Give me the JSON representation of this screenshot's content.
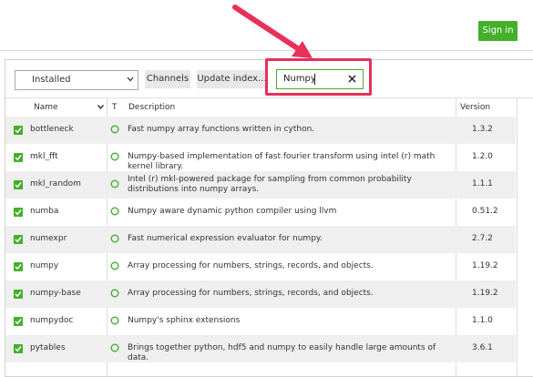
{
  "header": {
    "signin_label": "Sign in"
  },
  "toolbar": {
    "filter_selected": "Installed",
    "channels_label": "Channels",
    "update_index_label": "Update index...",
    "search_value": "Numpy"
  },
  "table": {
    "columns": {
      "name": "Name",
      "type": "T",
      "description": "Description",
      "version": "Version"
    },
    "rows": [
      {
        "name": "bottleneck",
        "description": "Fast numpy array functions written in cython.",
        "version": "1.3.2"
      },
      {
        "name": "mkl_fft",
        "description": "Numpy-based implementation of fast fourier transform using intel (r) math kernel library.",
        "version": "1.2.0"
      },
      {
        "name": "mkl_random",
        "description": "Intel (r) mkl-powered package for sampling from common probability distributions into numpy arrays.",
        "version": "1.1.1"
      },
      {
        "name": "numba",
        "description": "Numpy aware dynamic python compiler using llvm",
        "version": "0.51.2"
      },
      {
        "name": "numexpr",
        "description": "Fast numerical expression evaluator for numpy.",
        "version": "2.7.2"
      },
      {
        "name": "numpy",
        "description": "Array processing for numbers, strings, records, and objects.",
        "version": "1.19.2"
      },
      {
        "name": "numpy-base",
        "description": "Array processing for numbers, strings, records, and objects.",
        "version": "1.19.2"
      },
      {
        "name": "numpydoc",
        "description": "Numpy's sphinx extensions",
        "version": "1.1.0"
      },
      {
        "name": "pytables",
        "description": "Brings together python, hdf5 and numpy to easily handle large amounts of data.",
        "version": "3.6.1"
      }
    ]
  },
  "colors": {
    "accent": "#43b02a",
    "annotation": "#e8305a"
  }
}
